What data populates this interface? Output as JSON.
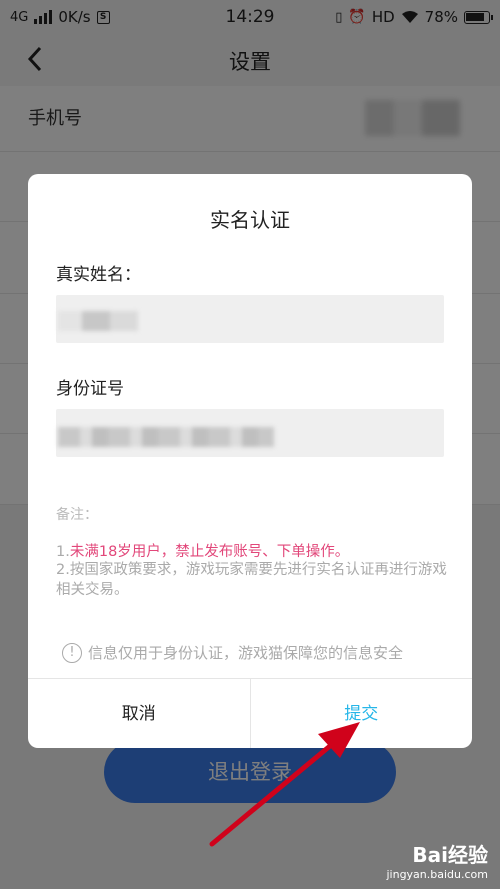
{
  "status_bar": {
    "network": "4G",
    "speed": "0K/s",
    "time": "14:29",
    "hd": "HD",
    "battery": "78%"
  },
  "nav": {
    "title": "设置"
  },
  "settings": {
    "phone_label": "手机号"
  },
  "logout": {
    "label": "退出登录"
  },
  "dialog": {
    "title": "实名认证",
    "name_label": "真实姓名：",
    "id_label": "身份证号",
    "note_title": "备注：",
    "note1_prefix": "1.",
    "note1_text": "未满18岁用户，禁止发布账号、下单操作。",
    "note2": "2.按国家政策要求，游戏玩家需要先进行实名认证再进行游戏相关交易。",
    "info_text": "信息仅用于身份认证，游戏猫保障您的信息安全",
    "cancel": "取消",
    "submit": "提交"
  },
  "watermark": {
    "brand": "Bai经验",
    "url": "jingyan.baidu.com"
  },
  "colors": {
    "accent": "#26b6e8",
    "warning": "#e2477a",
    "logout_button": "#3a7cea",
    "arrow": "#d0021b"
  }
}
